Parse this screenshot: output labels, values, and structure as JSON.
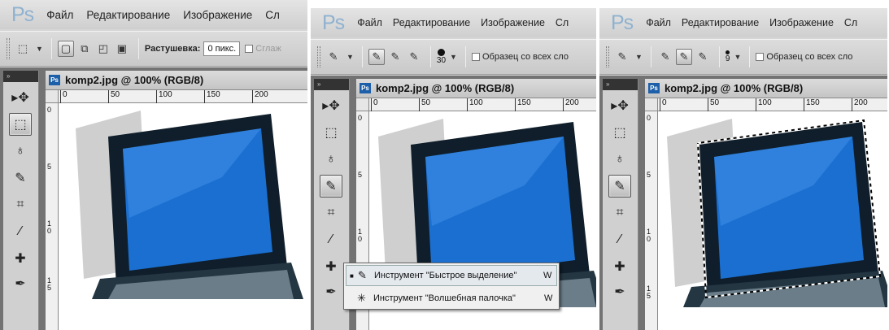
{
  "app": {
    "logo": "Ps",
    "menu": [
      "Файл",
      "Редактирование",
      "Изображение",
      "Сл",
      "Сл",
      "Сл"
    ]
  },
  "panel1": {
    "menu_visible": [
      "Файл",
      "Редактирование",
      "Изображение",
      "Сл"
    ],
    "feather_label": "Растушевка:",
    "feather_value": "0 пикс.",
    "smooth_label": "Сглаж"
  },
  "panel2": {
    "menu_visible": [
      "Файл",
      "Редактирование",
      "Изображение",
      "Сл"
    ],
    "brush_size": "30",
    "sample_all_label": "Образец со всех сло",
    "flyout": [
      {
        "label": "Инструмент \"Быстрое выделение\"",
        "key": "W",
        "icon": "quick-selection-icon",
        "selected": true
      },
      {
        "label": "Инструмент \"Волшебная палочка\"",
        "key": "W",
        "icon": "magic-wand-icon",
        "selected": false
      }
    ]
  },
  "panel3": {
    "menu_visible": [
      "Файл",
      "Редактирование",
      "Изображение",
      "Сл"
    ],
    "brush_size": "9",
    "sample_all_label": "Образец со всех сло"
  },
  "document": {
    "title": "komp2.jpg @ 100% (RGB/8)",
    "ruler_h": [
      "0",
      "50",
      "100",
      "150",
      "200"
    ],
    "ruler_v": [
      "0",
      "5",
      "1 0",
      "1 5"
    ]
  },
  "colors": {
    "screen_blue": "#1b6fd0",
    "laptop_body": "#0f1e2a",
    "shadow": "#cfcfcf",
    "ps_logo": "#8fb2d0"
  }
}
